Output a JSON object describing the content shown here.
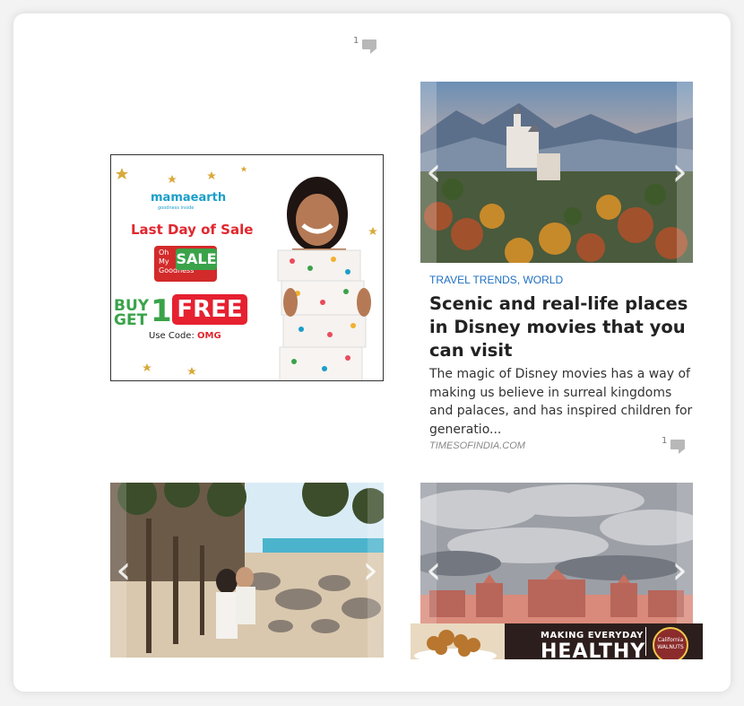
{
  "top_comment": {
    "count": "1"
  },
  "ad": {
    "brand": "mamaearth",
    "brand_tagline": "goodness inside",
    "headline": "Last Day of Sale",
    "omg_line1": "Oh",
    "omg_line2": "My",
    "omg_line3": "Goodness",
    "omg_sale": "SALE",
    "buy": "BUY",
    "get": "GET",
    "one": "1",
    "free": "FREE",
    "use_code_label": "Use Code:",
    "use_code": "OMG"
  },
  "article": {
    "categories": [
      "TRAVEL TRENDS",
      "WORLD"
    ],
    "title": "Scenic and real-life places in Disney movies that you can visit",
    "excerpt": "The magic of Disney movies has a way of making us believe in surreal kingdoms and palaces, and has inspired children for generatio...",
    "source": "TIMESOFINDIA.COM",
    "comment_count": "1"
  },
  "carousel": {
    "prev_glyph": "‹",
    "next_glyph": "›"
  },
  "banner": {
    "line1": "MAKING EVERYDAY",
    "line2": "HEALTHY",
    "logo_text": "California WALNUTS"
  },
  "colors": {
    "link": "#1f6fc1",
    "ad_red": "#e2262e",
    "ad_green": "#3aa34a"
  }
}
